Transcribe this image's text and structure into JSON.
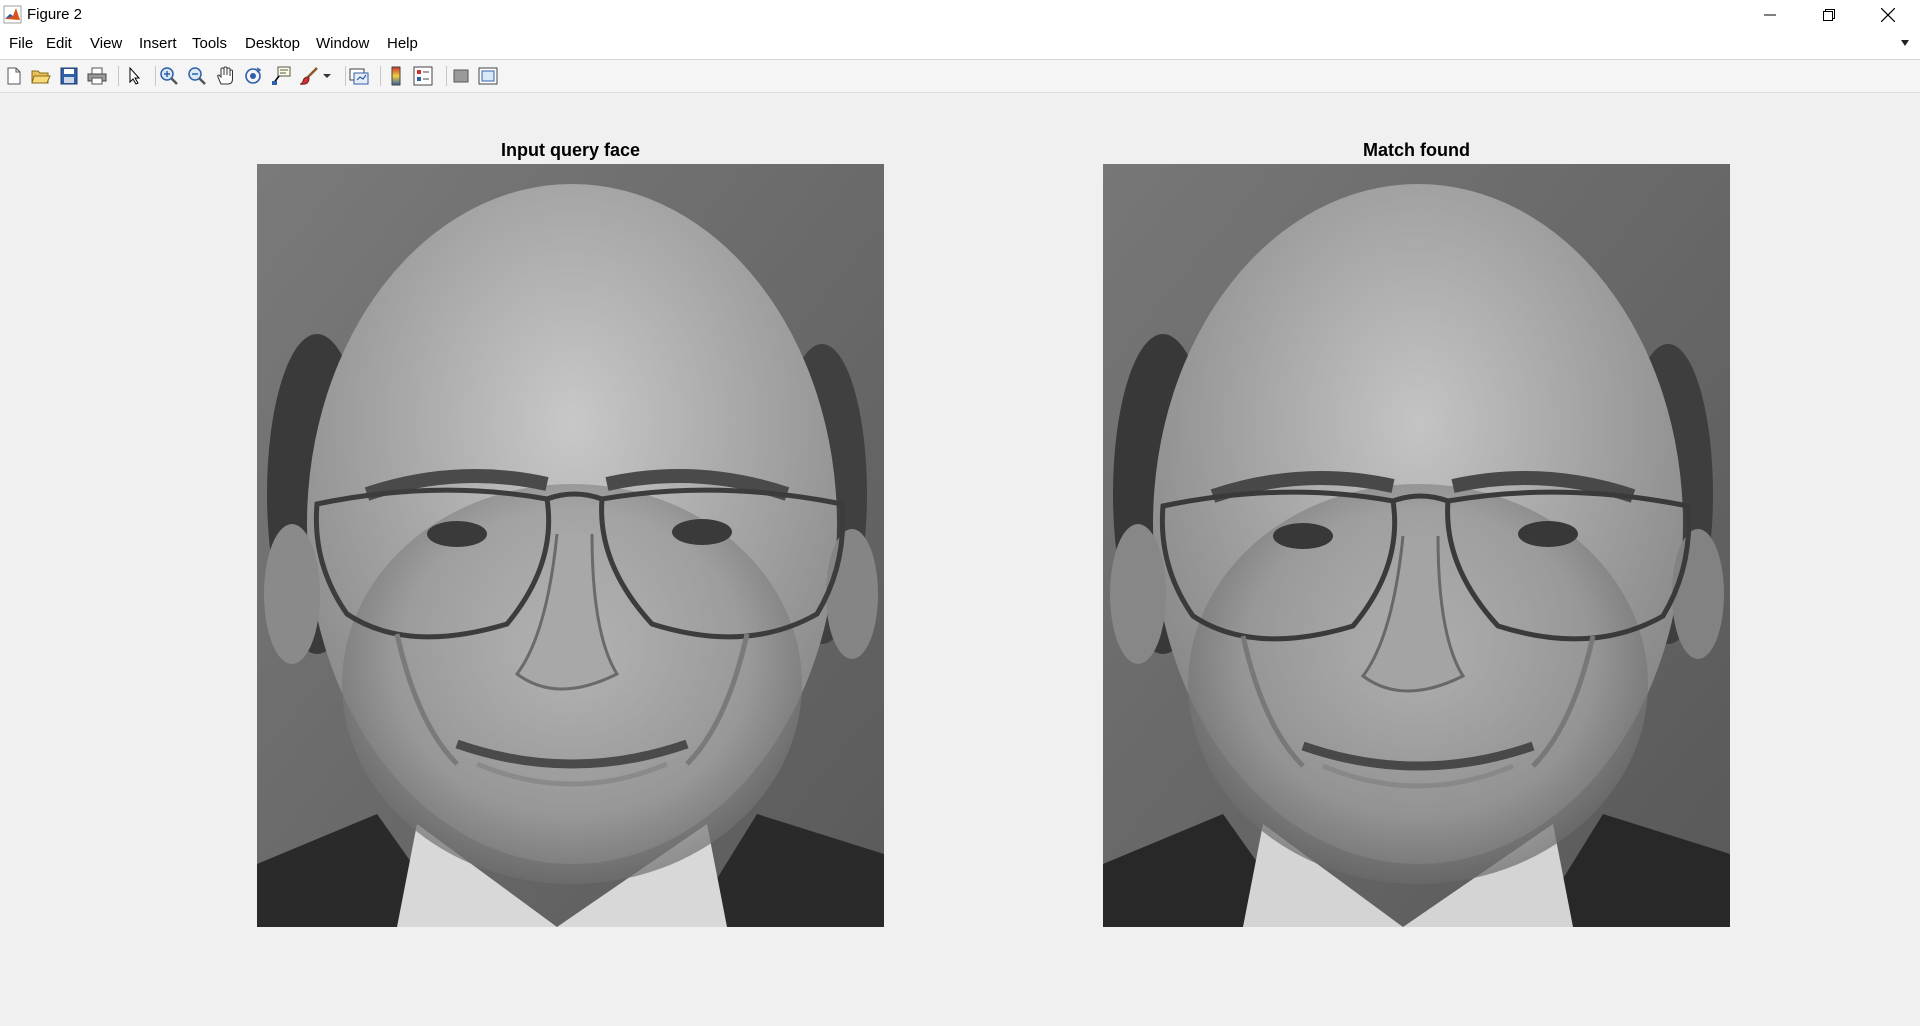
{
  "window": {
    "title": "Figure 2",
    "icon": "matlab-logo"
  },
  "window_controls": {
    "minimize_icon": "minimize-icon",
    "maximize_icon": "restore-icon",
    "close_icon": "close-icon"
  },
  "menu": {
    "items": [
      {
        "label": "File"
      },
      {
        "label": "Edit"
      },
      {
        "label": "View"
      },
      {
        "label": "Insert"
      },
      {
        "label": "Tools"
      },
      {
        "label": "Desktop"
      },
      {
        "label": "Window"
      },
      {
        "label": "Help"
      }
    ]
  },
  "toolbar": {
    "buttons": [
      "new-figure-icon",
      "open-file-icon",
      "save-icon",
      "print-icon",
      "edit-plot-arrow-icon",
      "zoom-in-icon",
      "zoom-out-icon",
      "pan-hand-icon",
      "rotate-3d-icon",
      "data-cursor-icon",
      "brush-icon",
      "link-plot-icon",
      "insert-colorbar-icon",
      "insert-legend-icon",
      "hide-plot-tools-icon",
      "show-plot-tools-icon"
    ]
  },
  "figure": {
    "left_title": "Input query face",
    "right_title": "Match found"
  },
  "colors": {
    "background": "#f0f0f0",
    "titlebar": "#ffffff",
    "accent": "#d95319"
  }
}
